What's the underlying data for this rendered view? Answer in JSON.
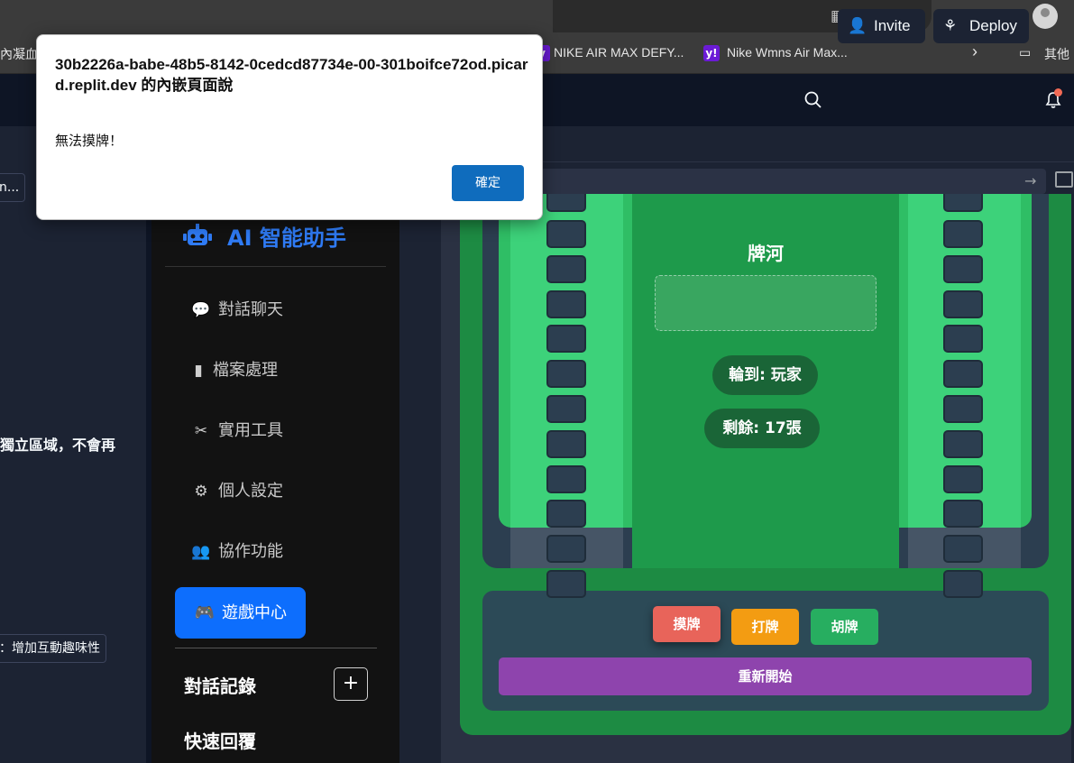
{
  "browser": {
    "bookmarks": [
      {
        "label": "內凝血"
      },
      {
        "label": "NIKE AIR MAX DEFY..."
      },
      {
        "label": "Nike Wmns Air Max..."
      },
      {
        "label": "其他"
      }
    ],
    "icons": [
      "apps-icon",
      "read-aloud-icon",
      "favorite-star-icon",
      "extensions-icon",
      "favorites-list-icon",
      "profile-icon"
    ]
  },
  "replit": {
    "invite_label": "Invite",
    "deploy_label": "Deploy",
    "notification_dot_color": "#f26a55"
  },
  "left_pane": {
    "chip_top": "n...",
    "text_fragment": "獨立區域，不會再",
    "chip_bottom": "：增加互動趣味性"
  },
  "sidebar": {
    "title": "AI 智能助手",
    "items": [
      {
        "label": "對話聊天",
        "icon": "comments-icon"
      },
      {
        "label": "檔案處理",
        "icon": "file-upload-icon"
      },
      {
        "label": "實用工具",
        "icon": "tools-icon"
      },
      {
        "label": "個人設定",
        "icon": "gear-icon"
      },
      {
        "label": "協作功能",
        "icon": "users-icon"
      }
    ],
    "active_item": {
      "label": "遊戲中心",
      "icon": "gamepad-icon"
    },
    "history_title": "對話記錄",
    "history_add": "+",
    "quick_reply_title": "快速回覆"
  },
  "game": {
    "river_label": "牌河",
    "turn_text": "輪到: 玩家",
    "remaining_text": "剩餘: 17張",
    "buttons": {
      "draw": "摸牌",
      "discard": "打牌",
      "win": "胡牌",
      "restart": "重新開始"
    },
    "colors": {
      "draw": "#e8645a",
      "discard": "#f39c12",
      "win": "#27ae60",
      "restart": "#8e44ad"
    }
  },
  "dialog": {
    "title": "30b2226a-babe-48b5-8142-0cedcd87734e-00-301boifce72od.picard.replit.dev 的內嵌頁面說",
    "message": "無法摸牌！",
    "ok_label": "確定"
  }
}
